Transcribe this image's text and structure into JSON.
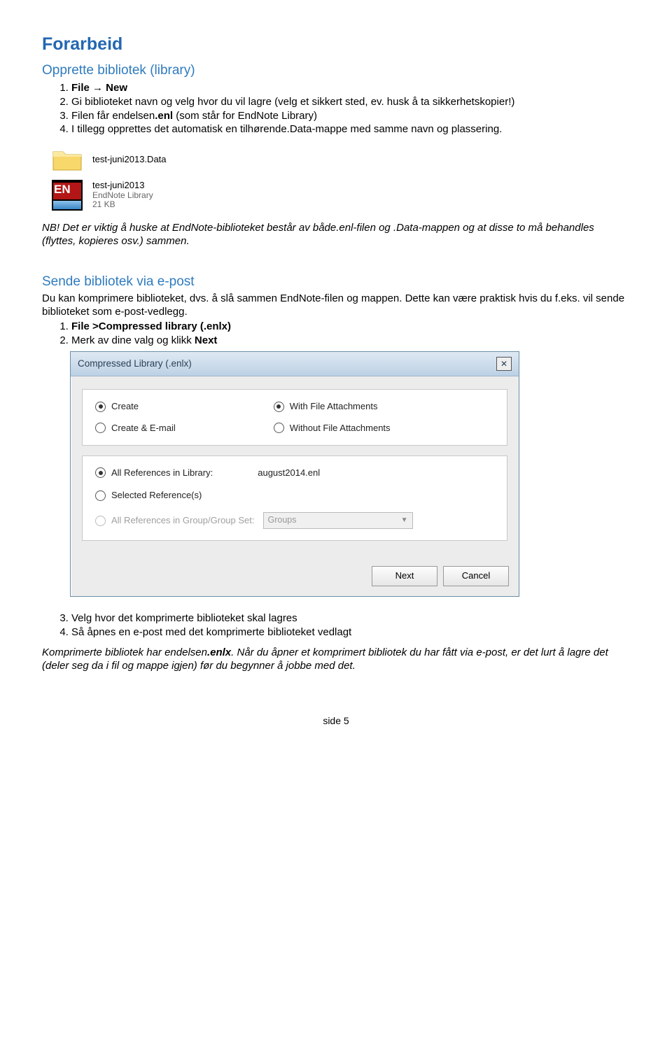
{
  "heading1": "Forarbeid",
  "section1": {
    "title": "Opprette bibliotek (library)",
    "steps": {
      "s1_a": "File ",
      "s1_arrow": "→",
      "s1_b": " New",
      "s2": "Gi biblioteket navn og velg hvor du vil lagre (velg et sikkert sted, ev. husk å ta sikkerhetskopier!)",
      "s3_a": "Filen får endelsen",
      "s3_b": ".enl",
      "s3_c": " (som står for EndNote Library)",
      "s4": "I tillegg opprettes det automatisk en tilhørende.Data-mappe med samme navn og plassering."
    }
  },
  "files": {
    "folder_name": "test-juni2013.Data",
    "enfile_name": "test-juni2013",
    "enfile_type": "EndNote Library",
    "enfile_size": "21 KB"
  },
  "note": "NB! Det er viktig å huske at EndNote-biblioteket består av både.enl-filen og .Data-mappen og at disse to må behandles (flyttes, kopieres osv.) sammen.",
  "section2": {
    "title": "Sende bibliotek via e-post",
    "intro": "Du kan komprimere biblioteket, dvs. å slå sammen EndNote-filen og mappen. Dette kan være praktisk hvis du f.eks. vil sende biblioteket som e-post-vedlegg.",
    "steps": {
      "s1": "File >Compressed library (.enlx)",
      "s2_a": "Merk av dine valg og klikk ",
      "s2_b": "Next"
    }
  },
  "dialog": {
    "title": "Compressed Library (.enlx)",
    "close": "✕",
    "opts": {
      "create": "Create",
      "create_email": "Create & E-mail",
      "with_att": "With File Attachments",
      "without_att": "Without File Attachments",
      "all_refs": "All References in Library:",
      "libname": "august2014.enl",
      "sel_ref": "Selected Reference(s)",
      "grp_refs": "All References in Group/Group Set:",
      "grp_val": "Groups"
    },
    "buttons": {
      "next": "Next",
      "cancel": "Cancel"
    }
  },
  "steps_after": {
    "s3": "Velg hvor det komprimerte biblioteket skal lagres",
    "s4": "Så åpnes en e-post med det komprimerte biblioteket vedlagt"
  },
  "closing": {
    "a": "Komprimerte bibliotek har endelsen",
    "b": ".enlx",
    "c": ". Når du åpner et komprimert bibliotek du har fått via e-post, er det lurt å lagre det (deler seg da i fil og mappe igjen) før du begynner å jobbe med det."
  },
  "page": "side 5"
}
